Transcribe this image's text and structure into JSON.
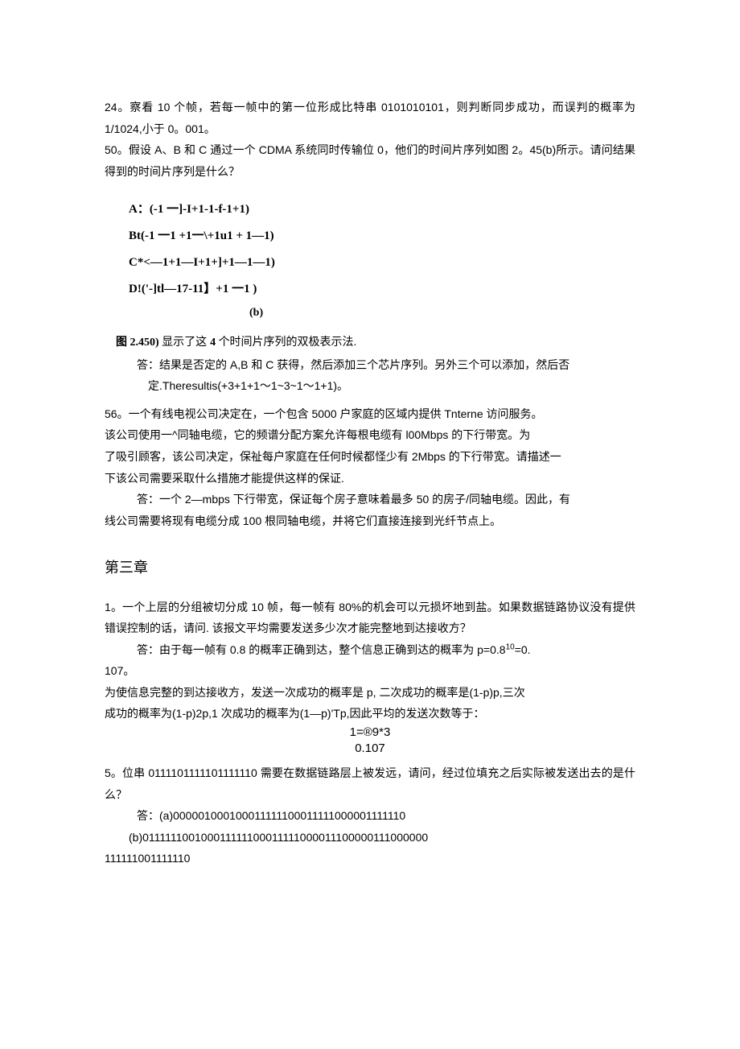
{
  "q24": {
    "text": "24。察看 10 个帧，若每一帧中的第一位形成比特串 0101010101，则判断同步成功，而误判的概率为 1/1024,小于 0。001。"
  },
  "q50": {
    "text": "50。假设 A、B 和 C 通过一个 CDMA 系统同时传输位 0，他们的时间片序列如图 2。45(b)所示。请问结果得到的时间片序列是什么？",
    "lineA": "A：(-1 一]-I+1-1-f-1+1)",
    "lineB": "Bt(-1 一1 +1一\\+1u1 + 1—1)",
    "lineC": "C*<—1+1—I+1+]+1—1—1)",
    "lineD": "D!('-]tl—17-11】+1 一1 )",
    "caption_b": "(b)",
    "fig_caption": "图 2.450) 显示了这 4 个时间片序列的双极表示法.",
    "answer1": "答：结果是否定的 A,B 和 C 获得，然后添加三个芯片序列。另外三个可以添加，然后否",
    "answer2": "定.Theresultis(+3+1+1～1~3~1～1+1)。"
  },
  "q56": {
    "l1": "56。一个有线电视公司决定在，一个包含 5000 户家庭的区域内提供 Tnterne 访问服务。",
    "l2": "该公司使用一^同轴电缆，它的频谱分配方案允许每根电缆有 l00Mbps 的下行带宽。为",
    "l3": "了吸引顾客，该公司决定，保祉每户家庭在任何时候都怪少有 2Mbps 的下行带宽。请描述一",
    "l4": "下该公司需要采取什么措施才能提供这样的保证.",
    "a1": "答：一个 2—mbps 下行带宽，保证每个房子意味着最多 50 的房子/同轴电缆。因此，有",
    "a2": "线公司需要将现有电缆分成 100 根同轴电缆，并将它们直接连接到光纤节点上。"
  },
  "chapter3": "第三章",
  "q1": {
    "l1": "1。一个上层的分组被切分成 10 帧，每一帧有 80%的机会可以元损坏地到盐。如果数据链路协议没有提供错误控制的话，请问. 该报文平均需要发送多少次才能完整地到达接收方？",
    "a_prefix": "答：由于每一帧有 0.8 的概率正确到达，整个信息正确到达的概率为 p=0.8",
    "a_exp": "10",
    "a_suffix": "=0.",
    "a2": "107。",
    "a3": "为使信息完整的到达接收方，发送一次成功的概率是 p, 二次成功的概率是(1-p)p,三次",
    "a4": "成功的概率为(1-p)2p,1 次成功的概率为(1—p)'Tp,因此平均的发送次数等于：",
    "eq1": "1=®9*3",
    "eq2": "0.107"
  },
  "q5": {
    "l1": "5。位串 0111101111101111110 需要在数据链路层上被发远，请问，经过位填充之后实际被发送出去的是什么？",
    "a1": "答：(a)000001000100011111100011111000001111110",
    "a2": "(b)011111100100011111100011111000011100000111000000",
    "a3": "111111001111110"
  }
}
